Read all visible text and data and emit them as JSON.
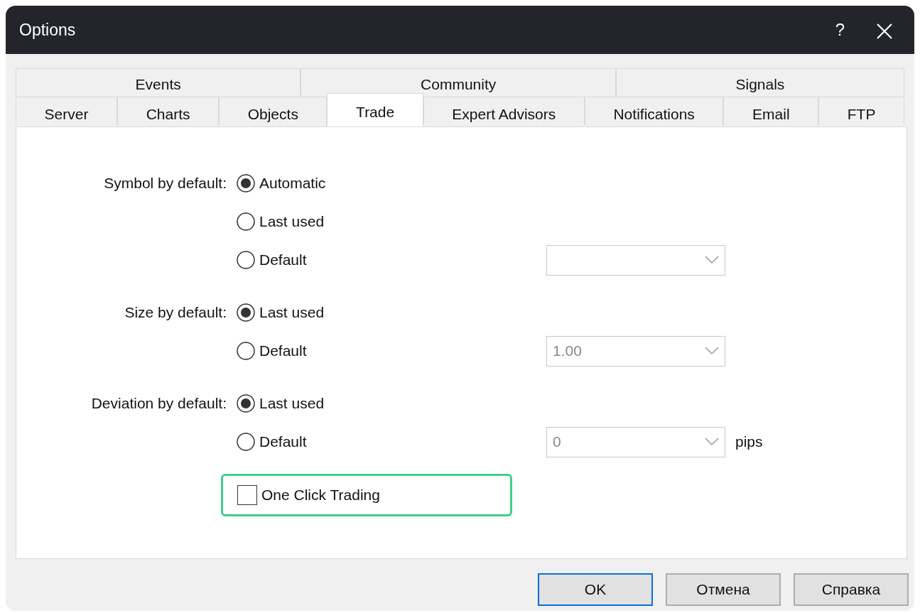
{
  "window": {
    "title": "Options",
    "help": "?"
  },
  "tab_rows": [
    [
      {
        "label": "Events",
        "selected": false
      },
      {
        "label": "Community",
        "selected": false
      },
      {
        "label": "Signals",
        "selected": false
      }
    ],
    [
      {
        "label": "Server",
        "selected": false
      },
      {
        "label": "Charts",
        "selected": false
      },
      {
        "label": "Objects",
        "selected": false
      },
      {
        "label": "Trade",
        "selected": true
      },
      {
        "label": "Expert Advisors",
        "selected": false
      },
      {
        "label": "Notifications",
        "selected": false
      },
      {
        "label": "Email",
        "selected": false
      },
      {
        "label": "FTP",
        "selected": false
      }
    ]
  ],
  "groups": [
    {
      "label": "Symbol by default:",
      "options": [
        {
          "label": "Automatic",
          "selected": true
        },
        {
          "label": "Last used",
          "selected": false
        },
        {
          "label": "Default",
          "selected": false,
          "dropdown": true
        }
      ]
    },
    {
      "label": "Size by default:",
      "options": [
        {
          "label": "Last used",
          "selected": true
        },
        {
          "label": "Default",
          "selected": false,
          "dropdown": true,
          "dropdown_value": "1.00"
        }
      ]
    },
    {
      "label": "Deviation by default:",
      "options": [
        {
          "label": "Last used",
          "selected": true
        },
        {
          "label": "Default",
          "selected": false,
          "dropdown": true,
          "dropdown_value": "0",
          "unit": "pips"
        }
      ]
    }
  ],
  "checkbox": {
    "label": "One Click Trading",
    "checked": false,
    "highlighted": true
  },
  "buttons": [
    {
      "label": "OK",
      "default": true
    },
    {
      "label": "Отмена",
      "default": false
    },
    {
      "label": "Справка",
      "default": false
    }
  ]
}
